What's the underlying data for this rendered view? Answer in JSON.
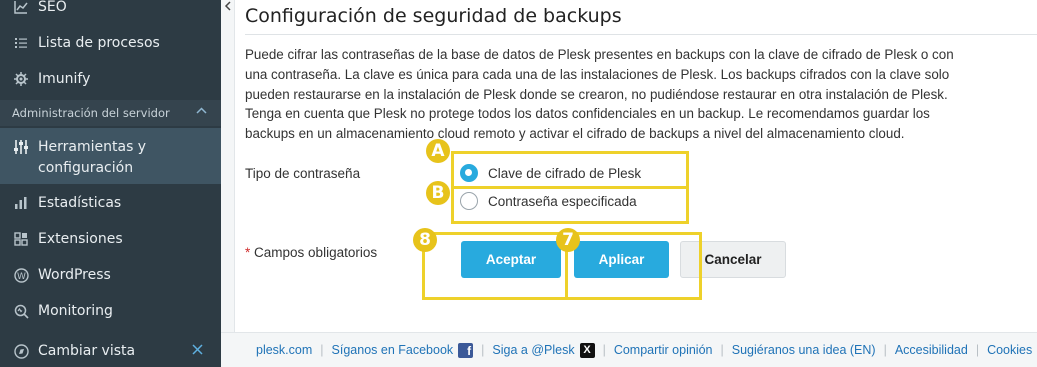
{
  "sidebar": {
    "items_top": [
      {
        "label": "SEO",
        "icon": "chart-icon"
      },
      {
        "label": "Lista de procesos",
        "icon": "list-icon"
      },
      {
        "label": "Imunify",
        "icon": "gear-icon"
      }
    ],
    "section_header": "Administración del servidor",
    "items_section": [
      {
        "label_line1": "Herramientas y",
        "label_line2": "configuración",
        "icon": "sliders-icon"
      },
      {
        "label": "Estadísticas",
        "icon": "bar-chart-icon"
      },
      {
        "label": "Extensiones",
        "icon": "extensions-icon"
      },
      {
        "label": "WordPress",
        "icon": "wordpress-icon"
      },
      {
        "label": "Monitoring",
        "icon": "monitoring-icon"
      }
    ],
    "bottom_item": {
      "label": "Cambiar vista",
      "icon": "compass-icon"
    }
  },
  "main": {
    "title": "Configuración de seguridad de backups",
    "description_lines": [
      "Puede cifrar las contraseñas de la base de datos de Plesk presentes en backups con la clave de cifrado de Plesk o con",
      "una contraseña. La clave es única para cada una de las instalaciones de Plesk. Los backups cifrados con la clave solo",
      "pueden restaurarse en la instalación de Plesk donde se crearon, no pudiéndose restaurar en otra instalación de Plesk.",
      "Tenga en cuenta que Plesk no protege todos los datos confidenciales en un backup. Le recomendamos guardar los",
      "backups en un almacenamiento cloud remoto y activar el cifrado de backups a nivel del almacenamiento cloud."
    ],
    "password_type_label": "Tipo de contraseña",
    "radio_options": [
      {
        "label": "Clave de cifrado de Plesk",
        "checked": true
      },
      {
        "label": "Contraseña especificada",
        "checked": false
      }
    ],
    "required_star": "*",
    "required_label": "Campos obligatorios",
    "buttons": {
      "accept": "Aceptar",
      "apply": "Aplicar",
      "cancel": "Cancelar"
    }
  },
  "annotations": {
    "a": "A",
    "b": "B",
    "eight": "8",
    "seven": "7"
  },
  "footer": {
    "links": [
      "plesk.com",
      "Síganos en Facebook",
      "Siga a @Plesk",
      "Compartir opinión",
      "Sugiéranos una idea (EN)",
      "Accesibilidad",
      "Cookies"
    ],
    "fb_glyph": "f",
    "x_glyph": "X"
  },
  "colors": {
    "sidebar_bg": "#2d3b44",
    "accent": "#28aade",
    "annotation": "#eed12a",
    "link": "#1f73b7"
  }
}
